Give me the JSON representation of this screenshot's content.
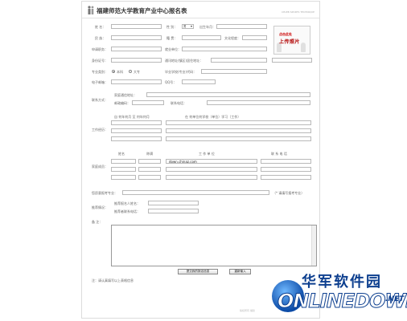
{
  "form": {
    "title": "福建师范大学教育产业中心报名表",
    "title_right": "CELEB SPORTS TECHNIQUE",
    "photo_line1": "点击此处",
    "photo_line2": "上传照片",
    "labels": {
      "name": "姓    名：",
      "gender": "性    别：",
      "birth": "出生年月：",
      "ethnicity": "民    族：",
      "native": "籍    贯：",
      "education": "文化程度：",
      "apply_post": "申请职务：",
      "employer": "就业单位：",
      "id_number": "身份证号：",
      "current_addr": "通讯地址(镇区)居住地址：",
      "major": "专业类别：",
      "radio_a": "本科",
      "radio_b": "大专",
      "grad_school": "毕业学校(专业)代码：",
      "email": "电子邮箱：",
      "phone": "QQ号：",
      "contact_section": "联系方式：",
      "contact_addr": "家庭通信地址：",
      "postcode": "邮政编码：",
      "mobile": "联系电话：",
      "work_section": "工作经历：",
      "work_head1": "自  何年何月 至 何年何月",
      "work_head2": "在  何单位何学校（单位）学习（工作）",
      "family_section": "家庭成员：",
      "family_head1": "姓名",
      "family_head2": "称谓",
      "family_head3": "工  作  单  位",
      "family_head4": "联  系  电  话",
      "expect": "您愿意报考专业：",
      "expect_note": "（*  请填写报考专业）",
      "referral": "推荐情况：",
      "ref_person": "推荐报名人姓名：",
      "ref_contact": "推荐者联系电话：",
      "notes": "备      注：",
      "footer_note": "注：请认真填写以上表格信息",
      "footer": "版权所有  福建"
    },
    "gender_value": "男",
    "submit": "提交我的报名信息",
    "reset": "重新输入",
    "watermark": "down.chinaz.com"
  },
  "logo": {
    "cn": "华军软件园",
    "en": "ONLINEDOWN",
    "net": ".NET"
  }
}
